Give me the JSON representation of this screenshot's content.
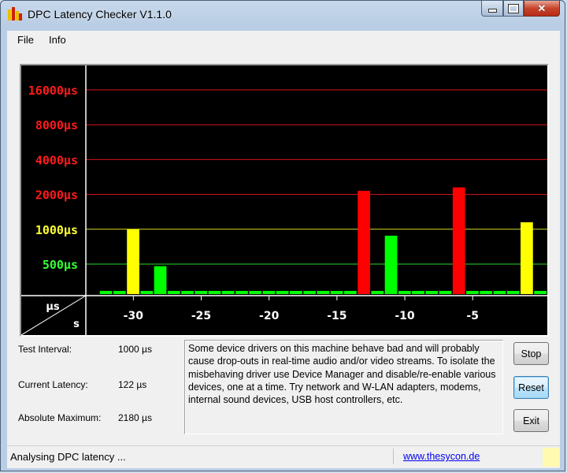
{
  "window": {
    "title": "DPC Latency Checker V1.1.0"
  },
  "menu": {
    "items": [
      "File",
      "Info"
    ]
  },
  "chart_data": {
    "type": "bar",
    "y_labels": [
      {
        "text": "16000µs",
        "value": 16000,
        "color": "#ff1a1a"
      },
      {
        "text": "8000µs",
        "value": 8000,
        "color": "#ff1a1a"
      },
      {
        "text": "4000µs",
        "value": 4000,
        "color": "#ff1a1a"
      },
      {
        "text": "2000µs",
        "value": 2000,
        "color": "#ff1a1a"
      },
      {
        "text": "1000µs",
        "value": 1000,
        "color": "#ffff33"
      },
      {
        "text": "500µs",
        "value": 500,
        "color": "#33ff33"
      }
    ],
    "x_ticks": [
      "-30",
      "-25",
      "-20",
      "-15",
      "-10",
      "-5"
    ],
    "x_tick_values": [
      -30,
      -25,
      -20,
      -15,
      -10,
      -5
    ],
    "corner_labels": {
      "top": "µs",
      "bottom": "s"
    },
    "x_range": [
      -33,
      0
    ],
    "y_scale": "log2",
    "bars": [
      {
        "x": -32,
        "value": 160
      },
      {
        "x": -31,
        "value": 160
      },
      {
        "x": -30,
        "value": 1000
      },
      {
        "x": -29,
        "value": 160
      },
      {
        "x": -28,
        "value": 480
      },
      {
        "x": -27,
        "value": 210
      },
      {
        "x": -26,
        "value": 150
      },
      {
        "x": -25,
        "value": 200
      },
      {
        "x": -24,
        "value": 180
      },
      {
        "x": -23,
        "value": 210
      },
      {
        "x": -22,
        "value": 170
      },
      {
        "x": -21,
        "value": 210
      },
      {
        "x": -20,
        "value": 210
      },
      {
        "x": -19,
        "value": 200
      },
      {
        "x": -18,
        "value": 160
      },
      {
        "x": -17,
        "value": 180
      },
      {
        "x": -16,
        "value": 180
      },
      {
        "x": -15,
        "value": 160
      },
      {
        "x": -14,
        "value": 160
      },
      {
        "x": -13,
        "value": 2150
      },
      {
        "x": -12,
        "value": 170
      },
      {
        "x": -11,
        "value": 880
      },
      {
        "x": -10,
        "value": 160
      },
      {
        "x": -9,
        "value": 200
      },
      {
        "x": -8,
        "value": 200
      },
      {
        "x": -7,
        "value": 200
      },
      {
        "x": -6,
        "value": 2300
      },
      {
        "x": -5,
        "value": 200
      },
      {
        "x": -4,
        "value": 180
      },
      {
        "x": -3,
        "value": 180
      },
      {
        "x": -2,
        "value": 210
      },
      {
        "x": -1,
        "value": 1150
      },
      {
        "x": 0,
        "value": 160
      }
    ],
    "colors": {
      "background": "#000000",
      "green": "#00ff00",
      "yellow": "#ffff00",
      "red": "#ff0000",
      "axis": "#ffffff"
    }
  },
  "info": {
    "test_interval_label": "Test Interval:",
    "test_interval_value": "1000 µs",
    "current_latency_label": "Current Latency:",
    "current_latency_value": "122 µs",
    "absolute_maximum_label": "Absolute Maximum:",
    "absolute_maximum_value": "2180 µs"
  },
  "message": "Some device drivers on this machine behave bad and will probably cause drop-outs in real-time audio and/or video streams. To isolate the misbehaving driver use Device Manager and disable/re-enable various devices, one at a time. Try network and W-LAN adapters, modems, internal sound devices, USB host controllers, etc.",
  "buttons": {
    "stop": "Stop",
    "reset": "Reset",
    "exit": "Exit"
  },
  "status": {
    "text": "Analysing DPC latency ...",
    "link": "www.thesycon.de"
  }
}
